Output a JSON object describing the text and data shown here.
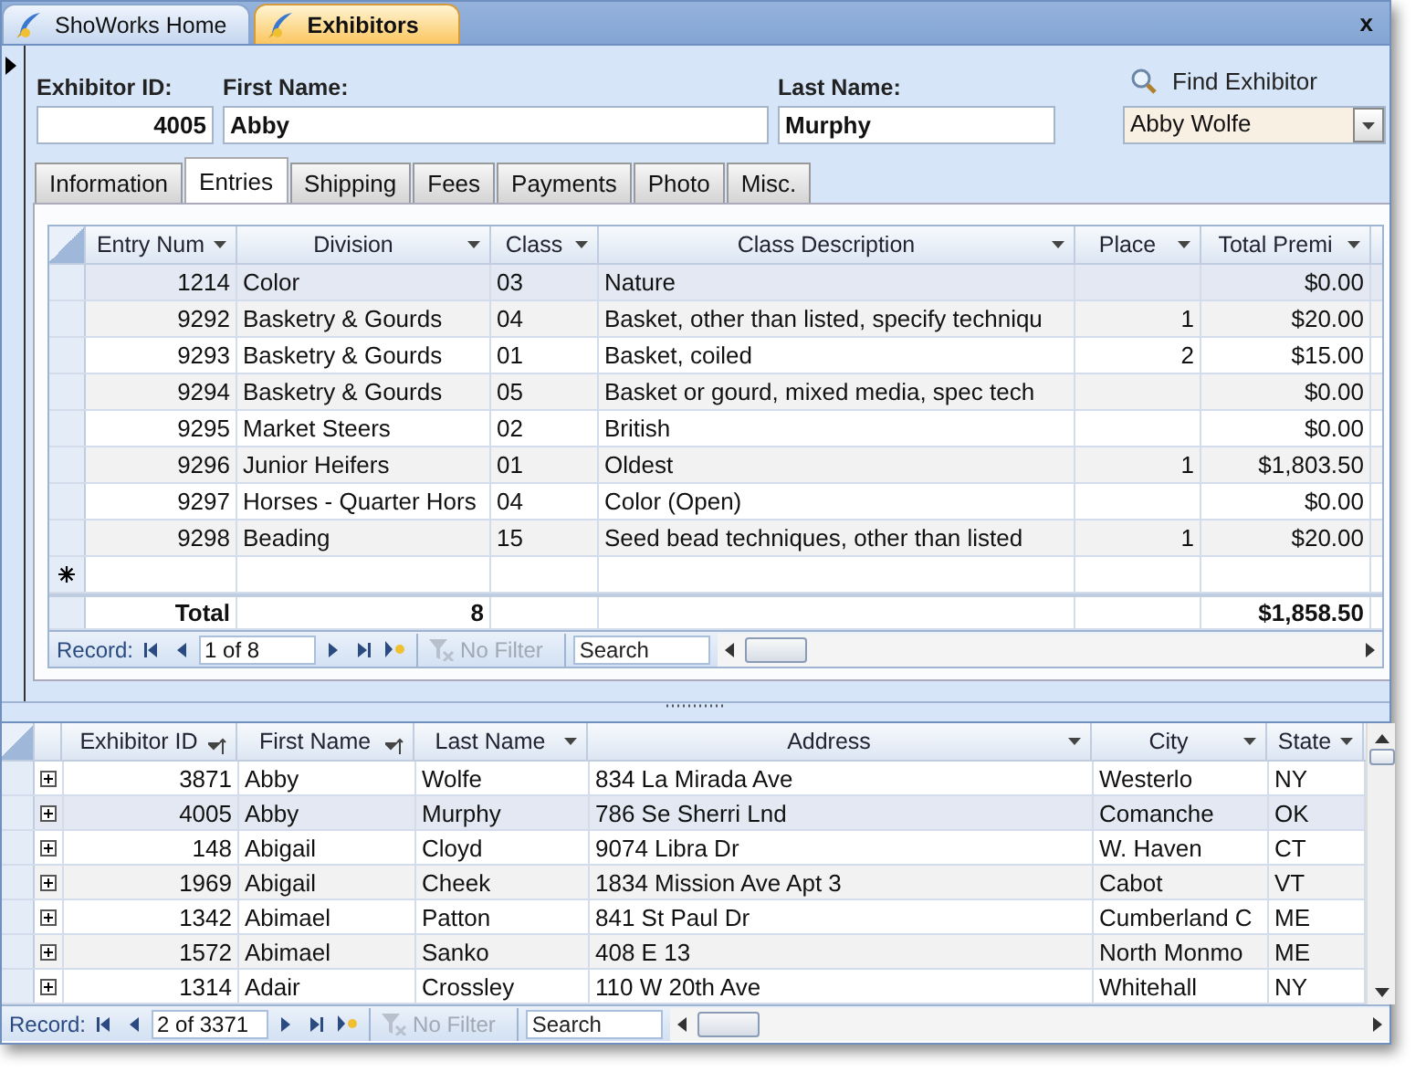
{
  "document_tabs": [
    {
      "label": "ShoWorks Home",
      "selected": false
    },
    {
      "label": "Exhibitors",
      "selected": true
    }
  ],
  "close_button": "x",
  "form": {
    "fields": [
      {
        "label": "Exhibitor ID:",
        "value": "4005"
      },
      {
        "label": "First Name:",
        "value": "Abby"
      },
      {
        "label": "Last Name:",
        "value": "Murphy"
      }
    ],
    "find": {
      "label": "Find Exhibitor",
      "value": "Abby Wolfe"
    },
    "tabs": [
      {
        "label": "Information",
        "selected": false
      },
      {
        "label": "Entries",
        "selected": true
      },
      {
        "label": "Shipping",
        "selected": false
      },
      {
        "label": "Fees",
        "selected": false
      },
      {
        "label": "Payments",
        "selected": false
      },
      {
        "label": "Photo",
        "selected": false
      },
      {
        "label": "Misc.",
        "selected": false
      }
    ],
    "entries": {
      "columns": [
        {
          "label": "Entry Num",
          "sorted": false
        },
        {
          "label": "Division",
          "sorted": false
        },
        {
          "label": "Class",
          "sorted": false
        },
        {
          "label": "Class Description",
          "sorted": false
        },
        {
          "label": "Place",
          "sorted": false
        },
        {
          "label": "Total Premi",
          "sorted": false
        }
      ],
      "rows": [
        {
          "entry_num": "1214",
          "division": "Color",
          "class": "03",
          "class_description": "Nature",
          "total_premium": "$0.00",
          "selected": true
        },
        {
          "entry_num": "9292",
          "division": "Basketry & Gourds",
          "class": "04",
          "class_description": "Basket, other than listed, specify techniqu",
          "place": "1",
          "total_premium": "$20.00",
          "selected": false
        },
        {
          "entry_num": "9293",
          "division": "Basketry & Gourds",
          "class": "01",
          "class_description": "Basket, coiled",
          "place": "2",
          "total_premium": "$15.00",
          "selected": false
        },
        {
          "entry_num": "9294",
          "division": "Basketry & Gourds",
          "class": "05",
          "class_description": "Basket or gourd, mixed media, spec tech",
          "total_premium": "$0.00",
          "selected": false
        },
        {
          "entry_num": "9295",
          "division": "Market Steers",
          "class": "02",
          "class_description": "British",
          "total_premium": "$0.00",
          "selected": false
        },
        {
          "entry_num": "9296",
          "division": "Junior Heifers",
          "class": "01",
          "class_description": "Oldest",
          "place": "1",
          "total_premium": "$1,803.50",
          "selected": false
        },
        {
          "entry_num": "9297",
          "division": "Horses - Quarter Hors",
          "class": "04",
          "class_description": "Color (Open)",
          "total_premium": "$0.00",
          "selected": false
        },
        {
          "entry_num": "9298",
          "division": "Beading",
          "class": "15",
          "class_description": "Seed bead techniques, other than listed",
          "place": "1",
          "total_premium": "$20.00",
          "selected": false
        }
      ],
      "total": {
        "label": "Total",
        "count": "8",
        "premium": "$1,858.50"
      },
      "navigator": {
        "label": "Record:",
        "position": "1 of 8",
        "filter": "No Filter",
        "filter_active": false,
        "search_placeholder": "Search"
      }
    }
  },
  "exhibitors": {
    "columns": [
      {
        "label": "Exhibitor ID",
        "sorted": true
      },
      {
        "label": "First Name",
        "sorted": true
      },
      {
        "label": "Last Name",
        "sorted": false
      },
      {
        "label": "Address",
        "sorted": false
      },
      {
        "label": "City",
        "sorted": false
      },
      {
        "label": "State",
        "sorted": false
      }
    ],
    "rows": [
      {
        "exhibitor_id": "3871",
        "first_name": "Abby",
        "last_name": "Wolfe",
        "address": "834 La Mirada Ave",
        "city": "Westerlo",
        "state": "NY",
        "selected": false
      },
      {
        "exhibitor_id": "4005",
        "first_name": "Abby",
        "last_name": "Murphy",
        "address": "786 Se Sherri Lnd",
        "city": "Comanche",
        "state": "OK",
        "selected": true
      },
      {
        "exhibitor_id": "148",
        "first_name": "Abigail",
        "last_name": "Cloyd",
        "address": "9074 Libra Dr",
        "city": "W. Haven",
        "state": "CT",
        "selected": false
      },
      {
        "exhibitor_id": "1969",
        "first_name": "Abigail",
        "last_name": "Cheek",
        "address": "1834 Mission Ave Apt 3",
        "city": "Cabot",
        "state": "VT",
        "selected": false
      },
      {
        "exhibitor_id": "1342",
        "first_name": "Abimael",
        "last_name": "Patton",
        "address": "841 St Paul Dr",
        "city": "Cumberland C",
        "state": "ME",
        "selected": false
      },
      {
        "exhibitor_id": "1572",
        "first_name": "Abimael",
        "last_name": "Sanko",
        "address": "408 E 13",
        "city": "North Monmo",
        "state": "ME",
        "selected": false
      },
      {
        "exhibitor_id": "1314",
        "first_name": "Adair",
        "last_name": "Crossley",
        "address": "110 W 20th Ave",
        "city": "Whitehall",
        "state": "NY",
        "selected": false
      }
    ],
    "navigator": {
      "label": "Record:",
      "position": "2 of 3371",
      "filter": "No Filter",
      "filter_active": false,
      "search_placeholder": "Search"
    }
  }
}
